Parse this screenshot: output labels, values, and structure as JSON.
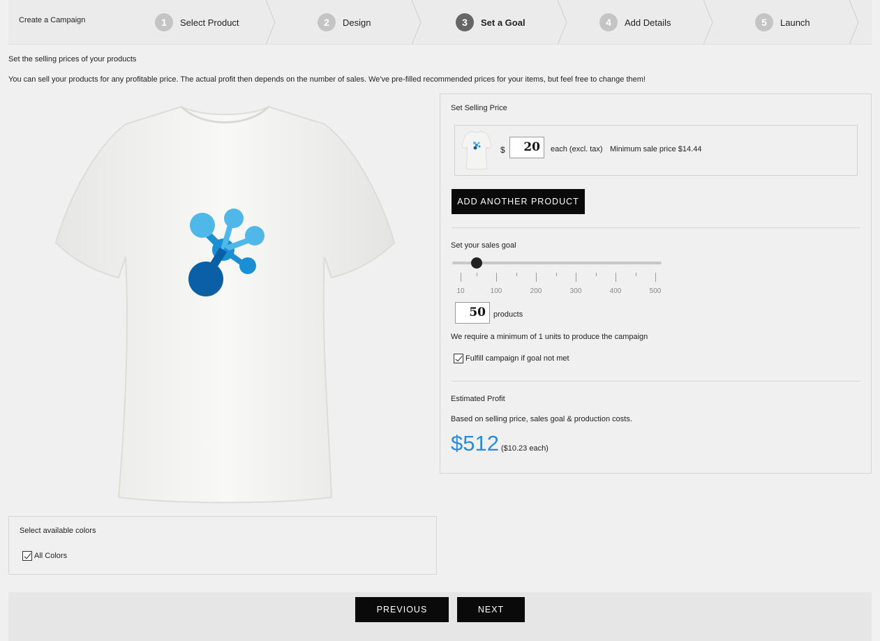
{
  "stepper": {
    "create_label": "Create a Campaign",
    "steps": [
      {
        "num": "1",
        "label": "Select Product"
      },
      {
        "num": "2",
        "label": "Design"
      },
      {
        "num": "3",
        "label": "Set a Goal"
      },
      {
        "num": "4",
        "label": "Add Details"
      },
      {
        "num": "5",
        "label": "Launch"
      }
    ],
    "active_step": 3
  },
  "intro": {
    "heading": "Set the selling prices of your products",
    "body": "You can sell your products for any profitable price. The actual profit then depends on the number of sales. We've pre-filled recommended prices for your items, but feel free to change them!"
  },
  "colors_box": {
    "title": "Select available colors",
    "all_colors_label": "All Colors",
    "all_colors_checked": true
  },
  "pricing": {
    "title": "Set Selling Price",
    "currency": "$",
    "price_value": "20",
    "each_label": "each (excl. tax)",
    "min_price_label": "Minimum sale price $14.44",
    "add_product_label": "ADD ANOTHER PRODUCT"
  },
  "sales_goal": {
    "title": "Set your sales goal",
    "tick_labels": [
      "10",
      "100",
      "200",
      "300",
      "400",
      "500"
    ],
    "slider_value": 50,
    "goal_value": "50",
    "products_label": "products",
    "minimum_note": "We require a minimum of  1 units to produce the campaign",
    "fulfill_label": "Fulfill campaign if goal not met",
    "fulfill_checked": true
  },
  "profit": {
    "title": "Estimated Profit",
    "note": "Based on selling price, sales goal & production costs.",
    "amount": "$512",
    "per_item": "($10.23 each)"
  },
  "footer": {
    "previous_label": "PREVIOUS",
    "next_label": "NEXT"
  },
  "colors": {
    "accent": "#2c8ad8",
    "button_bg": "#0a0a0a",
    "logo_light": "#4fb8e8",
    "logo_mid": "#1a8fd4",
    "logo_dark": "#0b5fa5"
  }
}
